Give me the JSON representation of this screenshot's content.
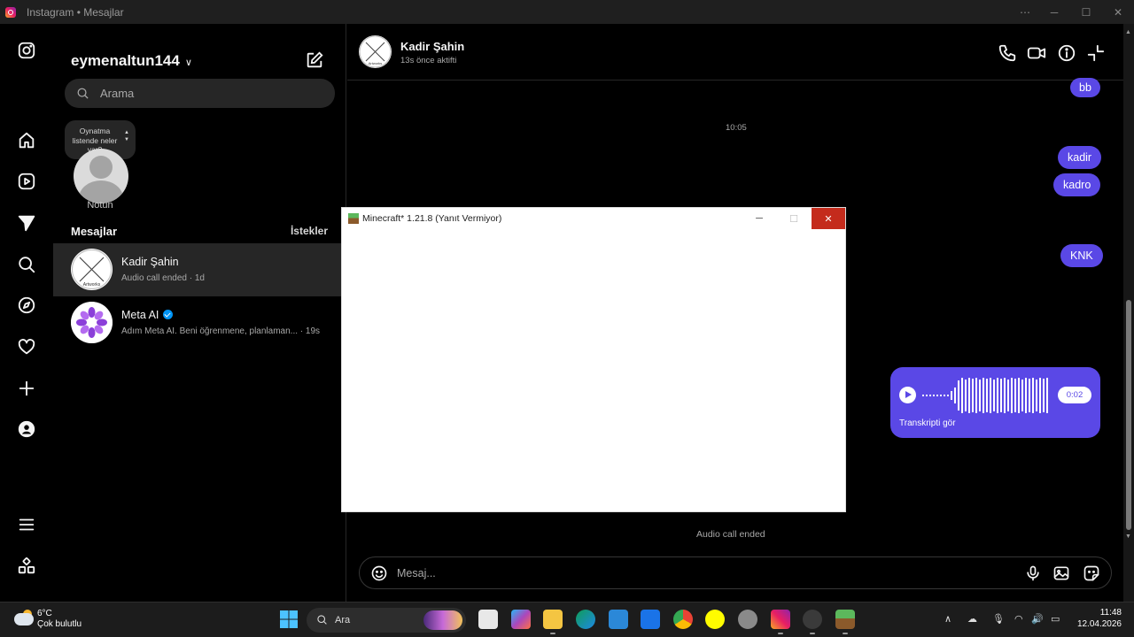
{
  "window": {
    "title": "Instagram • Mesajlar",
    "controls": [
      "⋯",
      "─",
      "☐",
      "✕"
    ]
  },
  "rail": {
    "items": [
      "instagram-logo-icon",
      "home-icon",
      "reels-icon",
      "messages-icon",
      "search-icon",
      "explore-icon",
      "heart-icon",
      "create-icon",
      "profile-icon",
      "menu-icon",
      "apps-icon"
    ]
  },
  "inbox": {
    "username": "eymenaltun144",
    "search_placeholder": "Arama",
    "note_bubble": "Oynatma listende neler var?",
    "note_label": "Notun",
    "section_title": "Mesajlar",
    "requests_link": "İstekler",
    "conversations": [
      {
        "name": "Kadir Şahin",
        "preview": "Audio call ended · 1d",
        "active": true
      },
      {
        "name": "Meta AI",
        "preview": "Adım Meta AI. Beni öğrenmene, planlaman... · 19s",
        "verified": true,
        "active": false
      }
    ]
  },
  "chat": {
    "contact_name": "Kadir Şahin",
    "status": "13s önce aktifti",
    "avatar_text": "Artworks",
    "messages": [
      {
        "text": "bb"
      },
      {
        "text": "kadir"
      },
      {
        "text": "kadro"
      },
      {
        "text": "KNK"
      }
    ],
    "timestamp": "10:05",
    "voice_message": {
      "duration": "0:02",
      "transcript_label": "Transkripti gör"
    },
    "call_ended": "Audio call ended",
    "composer_placeholder": "Mesaj..."
  },
  "dialog": {
    "title": "Minecraft* 1.21.8 (Yanıt Vermiyor)",
    "controls": [
      "─",
      "☐",
      "✕"
    ]
  },
  "taskbar": {
    "weather_temp": "6°C",
    "weather_desc": "Çok bulutlu",
    "search_label": "Ara",
    "time": "11:48",
    "date": "12.04.2026"
  },
  "colors": {
    "accent_bubble": "#5a48e6",
    "close_red": "#c42b1c",
    "verified_blue": "#0095f6"
  }
}
